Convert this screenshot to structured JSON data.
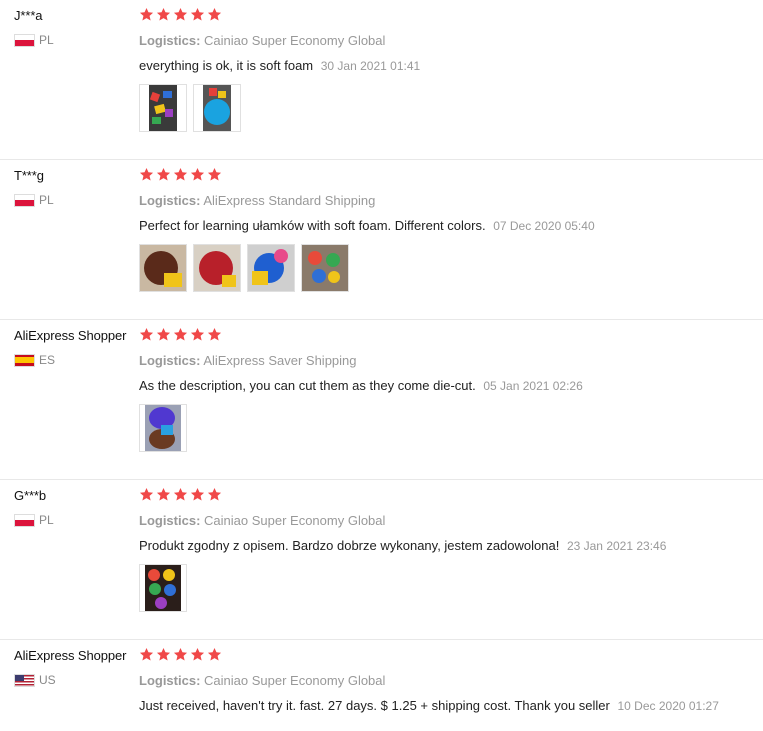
{
  "colors": {
    "star": "#f04848",
    "muted": "#999999",
    "divider": "#e8e8e8"
  },
  "logistics_label": "Logistics:",
  "reviews": [
    {
      "user": "J***a",
      "country": "PL",
      "flag": "poland-flag-icon",
      "stars": 5,
      "logistics": "Cainiao Super Economy Global",
      "text": "everything is ok, it is soft foam",
      "date": "30 Jan 2021 01:41",
      "photos": [
        "review-photo",
        "review-photo"
      ]
    },
    {
      "user": "T***g",
      "country": "PL",
      "flag": "poland-flag-icon",
      "stars": 5,
      "logistics": "AliExpress Standard Shipping",
      "text": "Perfect for learning ułamków with soft foam. Different colors.",
      "date": "07 Dec 2020 05:40",
      "photos": [
        "review-photo",
        "review-photo",
        "review-photo",
        "review-photo"
      ]
    },
    {
      "user": "AliExpress Shopper",
      "country": "ES",
      "flag": "spain-flag-icon",
      "stars": 5,
      "logistics": "AliExpress Saver Shipping",
      "text": "As the description, you can cut them as they come die-cut.",
      "date": "05 Jan 2021 02:26",
      "photos": [
        "review-photo"
      ]
    },
    {
      "user": "G***b",
      "country": "PL",
      "flag": "poland-flag-icon",
      "stars": 5,
      "logistics": "Cainiao Super Economy Global",
      "text": "Produkt zgodny z opisem. Bardzo dobrze wykonany, jestem zadowolona!",
      "date": "23 Jan 2021 23:46",
      "photos": [
        "review-photo"
      ]
    },
    {
      "user": "AliExpress Shopper",
      "country": "US",
      "flag": "usa-flag-icon",
      "stars": 5,
      "logistics": "Cainiao Super Economy Global",
      "text": "Just received, haven't try it. fast. 27 days. $ 1.25 + shipping cost. Thank you seller",
      "date": "10 Dec 2020 01:27",
      "photos": []
    }
  ]
}
